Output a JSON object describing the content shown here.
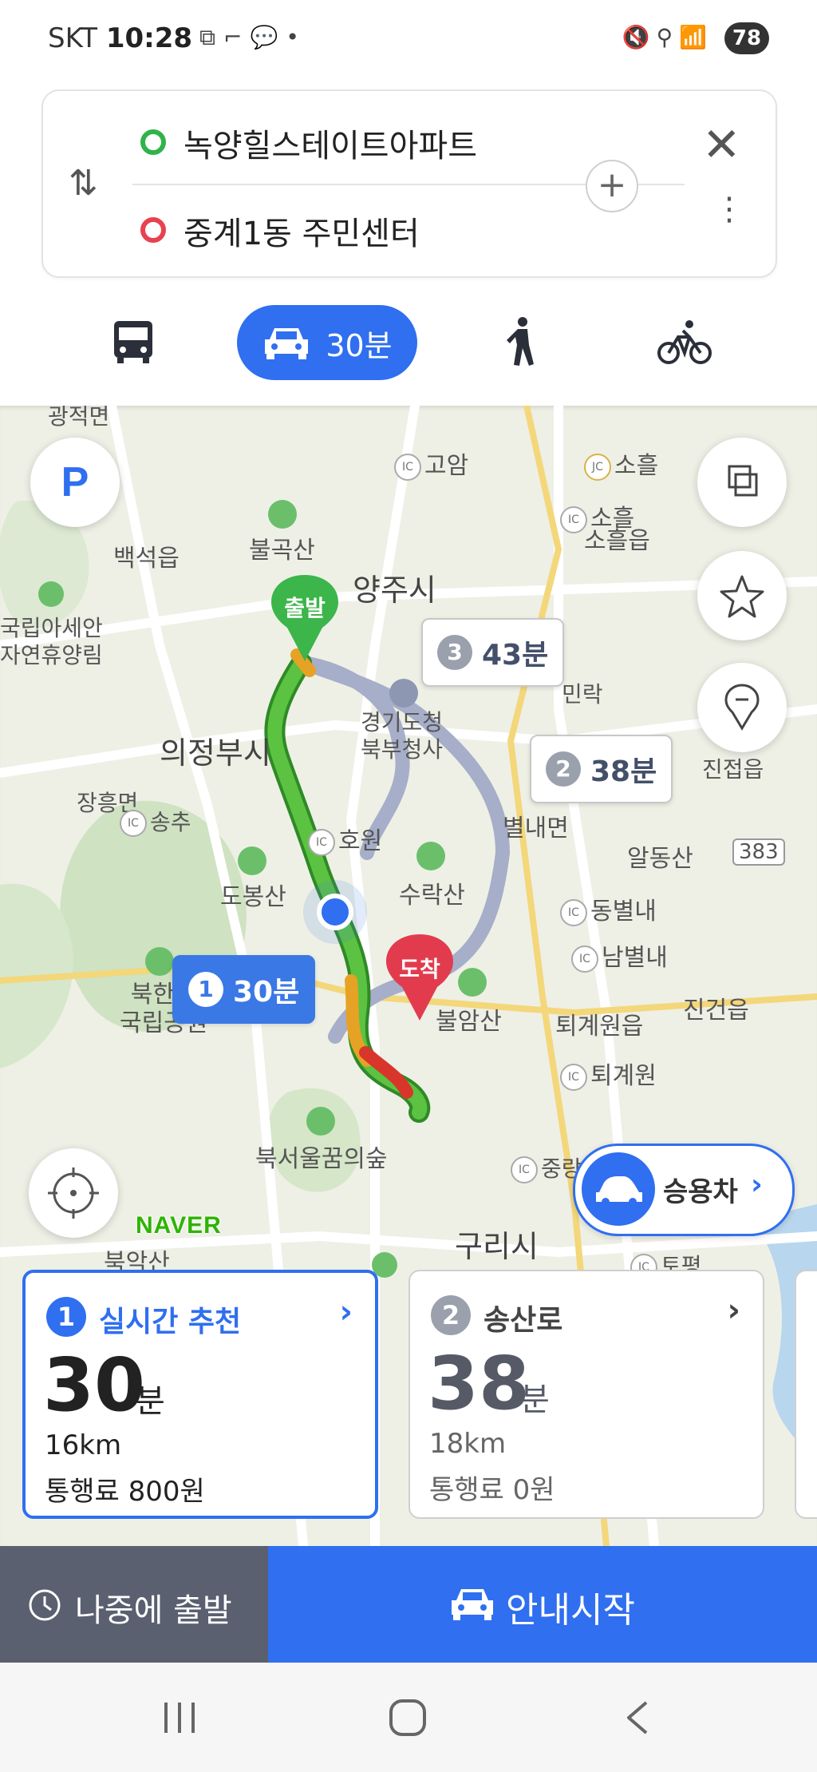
{
  "status_bar": {
    "carrier": "SKT",
    "time": "10:28",
    "battery": "78"
  },
  "search": {
    "origin": "녹양힐스테이트아파트",
    "destination": "중계1동 주민센터"
  },
  "modes": {
    "car_duration": "30분",
    "items": [
      "bus-icon",
      "car-icon",
      "walk-icon",
      "bike-icon"
    ]
  },
  "map": {
    "labels": {
      "gosan": "고암",
      "soheul_jc": "소흘",
      "soheul_ic": "소흘",
      "soheul_eup": "소흘읍",
      "baekseok": "백석읍",
      "bulgoksan": "불곡산",
      "yangju": "양주시",
      "arboretum": "국립아세안\n자연휴양림",
      "uijeongbu": "의정부시",
      "gyeonggi_north": "경기도청\n북부청사",
      "minrak": "민락",
      "jinjeop": "진접읍",
      "janghung": "장흥면",
      "songchu": "송추",
      "howon": "호원",
      "byeollae": "별내면",
      "aldongsan": "알동산",
      "route383": "383",
      "dobongsan": "도봉산",
      "suraksan": "수락산",
      "dongbyeollae": "동별내",
      "nambyeollae": "남별내",
      "bukhansan": "북한산\n국립공원",
      "bulamsan": "불암산",
      "toegyewon_eup": "퇴계원읍",
      "jingeon": "진건읍",
      "toegyewon_ic": "퇴계원",
      "seoul_dream_forest": "북서울꿈의숲",
      "jungnang": "중랑",
      "guri": "구리시",
      "bugaksan": "북악산",
      "topyeong": "토평",
      "top_partial": "광적면"
    },
    "pins": {
      "start": "출발",
      "end": "도착"
    },
    "route_bubbles": [
      {
        "num": "1",
        "time": "30분"
      },
      {
        "num": "2",
        "time": "38분"
      },
      {
        "num": "3",
        "time": "43분"
      }
    ],
    "parking_label": "P",
    "naver_logo": "NAVER",
    "vehicle_button": "승용차"
  },
  "routes": [
    {
      "num": "1",
      "title": "실시간 추천",
      "time": "30",
      "unit": "분",
      "distance": "16km",
      "toll": "통행료 800원",
      "color": "#2f6ff0"
    },
    {
      "num": "2",
      "title": "송산로",
      "time": "38",
      "unit": "분",
      "distance": "18km",
      "toll": "통행료 0원",
      "color": "#555a66"
    }
  ],
  "bottom": {
    "later": "나중에 출발",
    "start": "안내시작"
  },
  "colors": {
    "accent": "#2f6ff0",
    "start_pin": "#3cb54a",
    "end_pin": "#e23b4e",
    "alt_route": "#a6aec9"
  }
}
